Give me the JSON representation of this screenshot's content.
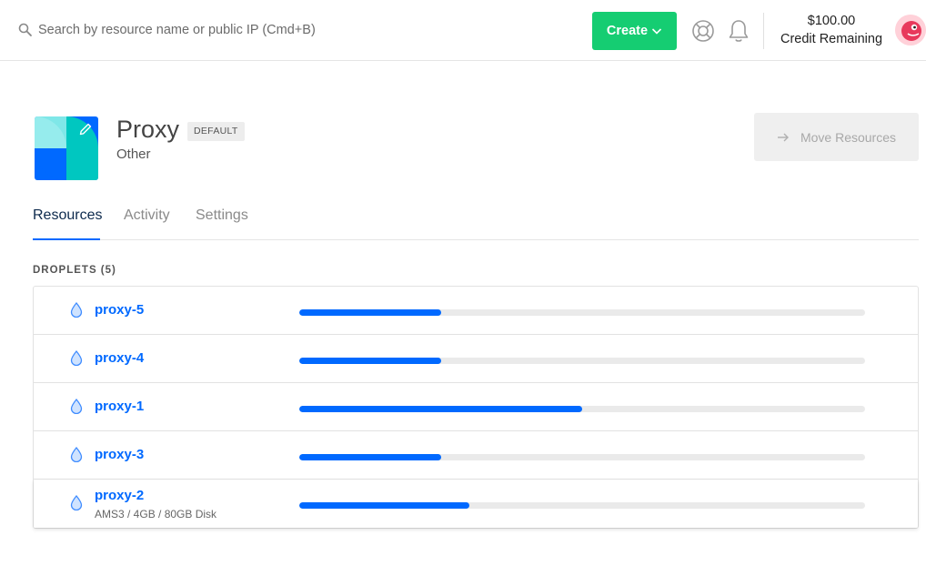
{
  "search": {
    "placeholder": "Search by resource name or public IP (Cmd+B)"
  },
  "header": {
    "create_label": "Create",
    "credit_amount": "$100.00",
    "credit_label": "Credit Remaining",
    "accent_color": "#15cd72"
  },
  "project": {
    "name": "Proxy",
    "badge": "DEFAULT",
    "purpose": "Other",
    "move_button_label": "Move Resources"
  },
  "tabs": [
    {
      "label": "Resources",
      "active": true
    },
    {
      "label": "Activity",
      "active": false
    },
    {
      "label": "Settings",
      "active": false
    }
  ],
  "droplets": {
    "section_title": "DROPLETS (5)",
    "items": [
      {
        "name": "proxy-5",
        "meta": "",
        "usage": 0.25
      },
      {
        "name": "proxy-4",
        "meta": "",
        "usage": 0.25
      },
      {
        "name": "proxy-1",
        "meta": "",
        "usage": 0.5
      },
      {
        "name": "proxy-3",
        "meta": "",
        "usage": 0.25
      },
      {
        "name": "proxy-2",
        "meta": "AMS3 / 4GB / 80GB Disk",
        "usage": 0.3
      }
    ],
    "bar_color": "#0069ff"
  },
  "icons": {
    "search": "search-icon",
    "help": "lifebuoy-icon",
    "notifications": "bell-icon",
    "droplet": "droplet-icon",
    "edit": "pencil-icon",
    "move": "arrow-right-icon"
  }
}
